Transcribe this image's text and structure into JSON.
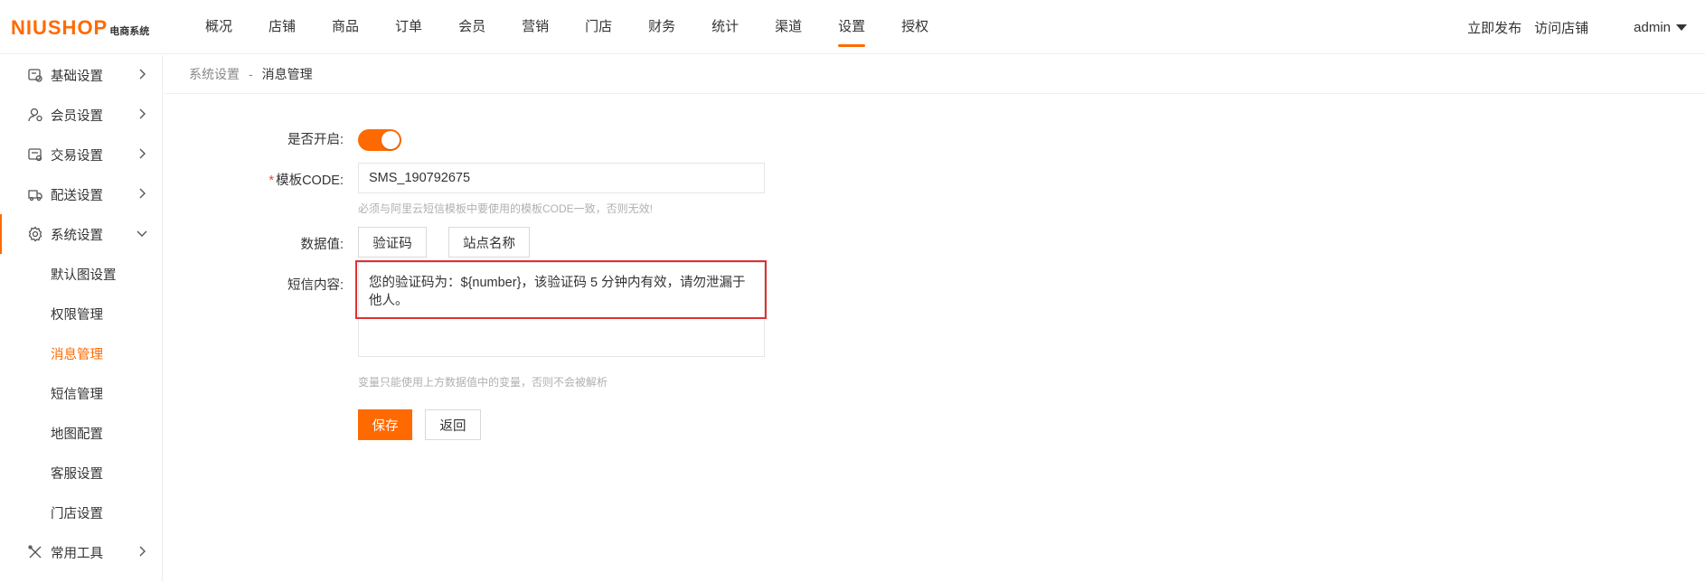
{
  "logo": {
    "brand": "NIUSHOP",
    "sub": "电商系统"
  },
  "topnav": [
    {
      "label": "概况"
    },
    {
      "label": "店铺"
    },
    {
      "label": "商品"
    },
    {
      "label": "订单"
    },
    {
      "label": "会员"
    },
    {
      "label": "营销"
    },
    {
      "label": "门店"
    },
    {
      "label": "财务"
    },
    {
      "label": "统计"
    },
    {
      "label": "渠道"
    },
    {
      "label": "设置",
      "active": true
    },
    {
      "label": "授权"
    }
  ],
  "topright": {
    "publish": "立即发布",
    "visit": "访问店铺",
    "user": "admin"
  },
  "sidebar": {
    "groups": [
      {
        "label": "基础设置",
        "icon": "basic-settings-icon"
      },
      {
        "label": "会员设置",
        "icon": "member-icon"
      },
      {
        "label": "交易设置",
        "icon": "trade-icon"
      },
      {
        "label": "配送设置",
        "icon": "delivery-icon"
      },
      {
        "label": "系统设置",
        "icon": "gear-icon",
        "open": true
      },
      {
        "label": "常用工具",
        "icon": "tools-icon"
      }
    ],
    "sub_items": [
      {
        "label": "默认图设置"
      },
      {
        "label": "权限管理"
      },
      {
        "label": "消息管理",
        "active": true
      },
      {
        "label": "短信管理"
      },
      {
        "label": "地图配置"
      },
      {
        "label": "客服设置"
      },
      {
        "label": "门店设置"
      }
    ]
  },
  "breadcrumb": {
    "root": "系统设置",
    "sep": "-",
    "current": "消息管理"
  },
  "form": {
    "enable_label": "是否开启:",
    "enabled": true,
    "code_required": "*",
    "code_label": "模板CODE:",
    "code_value": "SMS_190792675",
    "code_hint": "必须与阿里云短信模板中要使用的模板CODE一致，否则无效!",
    "vars_label": "数据值:",
    "vars": [
      "验证码",
      "站点名称"
    ],
    "content_label": "短信内容:",
    "content_value": "您的验证码为：${number}，该验证码 5 分钟内有效，请勿泄漏于他人。",
    "content_hint": "变量只能使用上方数据值中的变量，否则不会被解析",
    "save_label": "保存",
    "back_label": "返回"
  },
  "colors": {
    "accent": "#ff6a00",
    "highlight": "#e03131"
  }
}
